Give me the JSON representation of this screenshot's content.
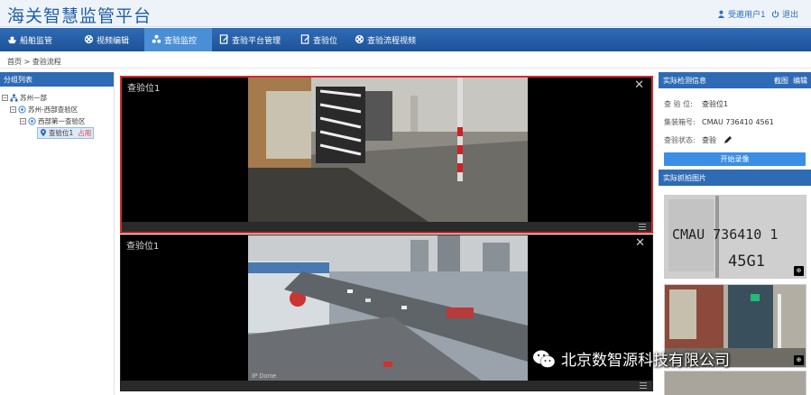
{
  "app": {
    "title": "海关智慧监管平台",
    "user": "受邀用户1",
    "logout": "退出"
  },
  "nav": [
    {
      "label": "船舶监管",
      "icon": "ship-icon",
      "active": false
    },
    {
      "label": "视频编辑",
      "icon": "film-reel-icon",
      "active": false
    },
    {
      "label": "查验监控",
      "icon": "monitor-group-icon",
      "active": true
    },
    {
      "label": "查验平台管理",
      "icon": "document-edit-icon",
      "active": false
    },
    {
      "label": "查验位",
      "icon": "document-edit-icon",
      "active": false
    },
    {
      "label": "查验流程视频",
      "icon": "film-reel-icon",
      "active": false
    }
  ],
  "breadcrumb": {
    "home": "首页",
    "separator": ">",
    "current": "查验流程"
  },
  "left": {
    "header": "分组列表",
    "tree": [
      {
        "label": "苏州一部",
        "level": 0
      },
      {
        "label": "苏州-西部查验区",
        "level": 1
      },
      {
        "label": "西部第一查验区",
        "level": 2
      },
      {
        "label": "查验位1",
        "level": 3,
        "badge": "占用"
      }
    ]
  },
  "videos": [
    {
      "label": "查验位1"
    },
    {
      "label": "查验位1",
      "overlay": "IP Dome"
    }
  ],
  "right": {
    "detect": {
      "header": "实际检测信息",
      "link1": "截图",
      "link2": "编辑",
      "rows": [
        {
          "k": "查 验 位:",
          "v": "查验位1"
        },
        {
          "k": "集装箱号:",
          "v": "CMAU 736410 4561"
        },
        {
          "k": "查验状态:",
          "v": "查验"
        }
      ],
      "button": "开始录像"
    },
    "captures": {
      "header": "实际抓拍图片",
      "plate_line1": "CMAU 736410 1",
      "plate_line2": "45G1"
    }
  },
  "watermark": "北京数智源科技有限公司"
}
